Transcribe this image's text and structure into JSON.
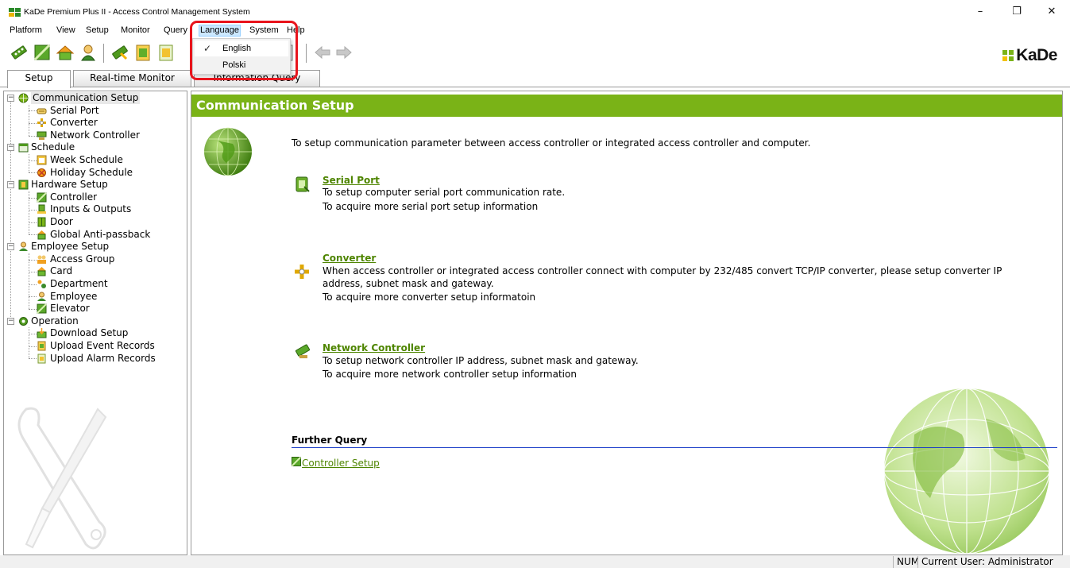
{
  "window": {
    "title": "KaDe Premium Plus II - Access Control Management System",
    "minimize": "–",
    "restore": "❐",
    "close": "✕"
  },
  "menubar": {
    "items": [
      "Platform",
      "View",
      "Setup",
      "Monitor",
      "Query",
      "Language",
      "System",
      "Help"
    ],
    "active": "Language"
  },
  "language_menu": {
    "items": [
      {
        "label": "English",
        "checked": true
      },
      {
        "label": "Polski",
        "checked": false
      }
    ]
  },
  "toolbar": {
    "logo_text": "KaDe"
  },
  "tabs": [
    {
      "label": "Setup",
      "selected": true
    },
    {
      "label": "Real-time Monitor",
      "selected": false
    },
    {
      "label": "Information Query",
      "selected": false
    }
  ],
  "tree": {
    "communication_setup": "Communication Setup",
    "serial_port": "Serial Port",
    "converter": "Converter",
    "network_controller": "Network Controller",
    "schedule": "Schedule",
    "week_schedule": "Week Schedule",
    "holiday_schedule": "Holiday Schedule",
    "hardware_setup": "Hardware Setup",
    "controller": "Controller",
    "inputs_outputs": "Inputs & Outputs",
    "door": "Door",
    "global_anti_passback": "Global Anti-passback",
    "employee_setup": "Employee Setup",
    "access_group": "Access Group",
    "card": "Card",
    "department": "Department",
    "employee": "Employee",
    "elevator": "Elevator",
    "operation": "Operation",
    "download_setup": "Download Setup",
    "upload_event_records": "Upload Event Records",
    "upload_alarm_records": "Upload Alarm Records"
  },
  "content": {
    "header": "Communication Setup",
    "intro": "To setup communication parameter between access controller or integrated access controller and computer.",
    "serial_port": {
      "title": "Serial Port",
      "line1": "To setup computer serial port communication rate.",
      "line2": "To acquire more serial port setup information"
    },
    "converter": {
      "title": "Converter",
      "line1": "When access controller or integrated access controller connect with computer by 232/485 convert TCP/IP converter, please setup converter IP",
      "line2": "address, subnet mask and gateway.",
      "line3": "To acquire more converter setup informatoin"
    },
    "network_controller": {
      "title": "Network Controller",
      "line1": "To setup network controller IP address, subnet mask and gateway.",
      "line2": "To acquire more network controller setup information"
    },
    "further_query": {
      "title": "Further Query",
      "link": "Controller Setup"
    }
  },
  "statusbar": {
    "num": "NUM",
    "user": "Current User: Administrator"
  },
  "colors": {
    "accent_green": "#7ab317",
    "link_green": "#4e8500",
    "highlight_red": "#e8141c"
  }
}
